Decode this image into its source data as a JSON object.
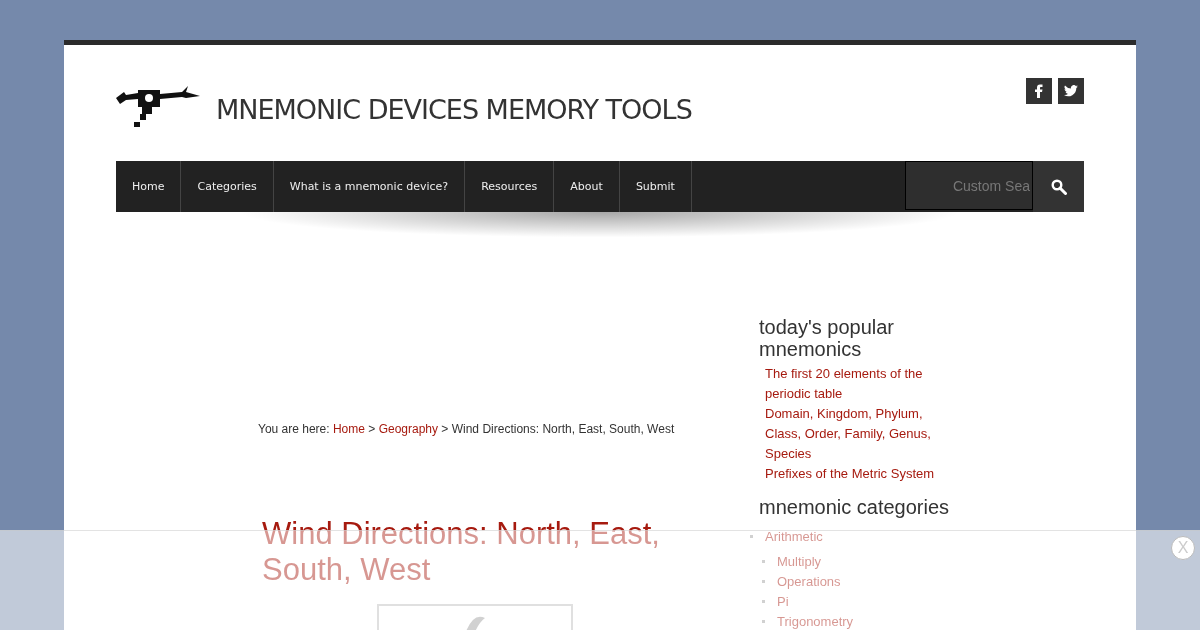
{
  "site_title": "MNEMONIC DEVICES MEMORY TOOLS",
  "social": [
    {
      "kind": "facebook"
    },
    {
      "kind": "twitter"
    }
  ],
  "nav": [
    {
      "label": "Home"
    },
    {
      "label": "Categories"
    },
    {
      "label": "What is a mnemonic device?"
    },
    {
      "label": "Resources"
    },
    {
      "label": "About"
    },
    {
      "label": "Submit"
    }
  ],
  "search": {
    "placeholder": "Custom Sea"
  },
  "breadcrumb": {
    "prefix": "You are here:",
    "separator": ">",
    "links": [
      "Home",
      "Geography"
    ],
    "current": "Wind Directions: North, East, South, West"
  },
  "article": {
    "title": "Wind Directions: North, East, South, West"
  },
  "sidebar": {
    "popular": {
      "title": "today's popular mnemonics",
      "items": [
        "The first 20 elements of the periodic table",
        "Domain, Kingdom, Phylum, Class, Order, Family, Genus, Species",
        "Prefixes of the Metric System"
      ]
    },
    "categories": {
      "title": "mnemonic categories",
      "items": [
        {
          "label": "Arithmetic",
          "children": [
            {
              "label": "Multiply"
            },
            {
              "label": "Operations"
            },
            {
              "label": "Pi"
            },
            {
              "label": "Trigonometry"
            }
          ]
        }
      ]
    }
  },
  "overlay": {
    "close": "X"
  }
}
